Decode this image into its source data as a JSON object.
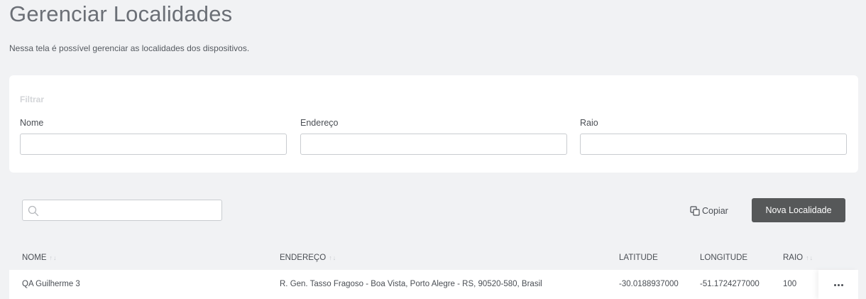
{
  "page": {
    "title": "Gerenciar Localidades",
    "subtitle": "Nessa tela é possível gerenciar as localidades dos dispositivos."
  },
  "filter": {
    "title": "Filtrar",
    "fields": [
      {
        "label": "Nome",
        "value": ""
      },
      {
        "label": "Endereço",
        "value": ""
      },
      {
        "label": "Raio",
        "value": ""
      }
    ]
  },
  "toolbar": {
    "search_value": "",
    "copy_label": "Copiar",
    "new_label": "Nova Localidade"
  },
  "table": {
    "columns": [
      {
        "label": "NOME",
        "sortable": true
      },
      {
        "label": "ENDEREÇO",
        "sortable": true
      },
      {
        "label": "LATITUDE",
        "sortable": false
      },
      {
        "label": "LONGITUDE",
        "sortable": false
      },
      {
        "label": "RAIO",
        "sortable": true
      }
    ],
    "rows": [
      {
        "nome": "QA Guilherme 3",
        "endereco": "R. Gen. Tasso Fragoso - Boa Vista, Porto Alegre - RS, 90520-580, Brasil",
        "latitude": "-30.0188937000",
        "longitude": "-51.1724277000",
        "raio": "100"
      }
    ]
  },
  "icons": {
    "search": "search-icon",
    "copy": "copy-icon",
    "sort": "sort-arrows-icon",
    "more": "more-horizontal-icon"
  },
  "colors": {
    "background": "#f1f2f4",
    "card": "#ffffff",
    "primary_button": "#565859",
    "title": "#6b6f76"
  }
}
